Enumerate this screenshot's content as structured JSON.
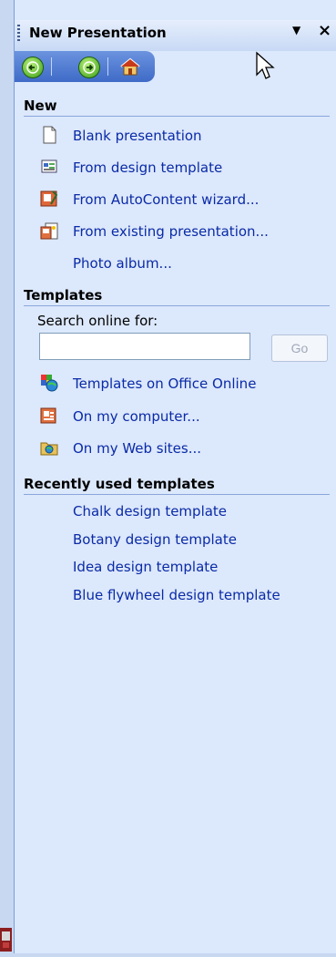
{
  "header": {
    "title": "New Presentation",
    "menu_icon": "dropdown-arrow-icon",
    "close_label": "×"
  },
  "nav": {
    "back_icon": "back-arrow-icon",
    "forward_icon": "forward-arrow-icon",
    "home_icon": "home-icon"
  },
  "sections": {
    "new": {
      "heading": "New",
      "items": [
        {
          "label": "Blank presentation",
          "icon": "blank-page-icon"
        },
        {
          "label": "From design template",
          "icon": "design-template-icon"
        },
        {
          "label": "From AutoContent wizard...",
          "icon": "autocontent-wizard-icon"
        },
        {
          "label": "From existing presentation...",
          "icon": "existing-presentation-icon"
        },
        {
          "label": "Photo album...",
          "icon": ""
        }
      ]
    },
    "templates": {
      "heading": "Templates",
      "search_label": "Search online for:",
      "search_value": "",
      "go_label": "Go",
      "items": [
        {
          "label": "Templates on Office Online",
          "icon": "office-online-icon"
        },
        {
          "label": "On my computer...",
          "icon": "my-computer-icon"
        },
        {
          "label": "On my Web sites...",
          "icon": "web-sites-folder-icon"
        }
      ]
    },
    "recent": {
      "heading": "Recently used templates",
      "items": [
        {
          "label": "Chalk design template"
        },
        {
          "label": "Botany design template"
        },
        {
          "label": "Idea design template"
        },
        {
          "label": "Blue flywheel design template"
        }
      ]
    }
  },
  "colors": {
    "pane_bg": "#dce8fb",
    "link": "#0a2aa7",
    "nav_bar": "#3f6bc7"
  }
}
